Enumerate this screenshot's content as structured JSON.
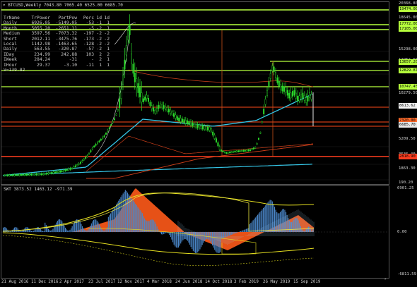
{
  "main": {
    "title": "BTCUSD,Weekly  7043.80 7065.40 6525.00 6685.70",
    "table": {
      "header": [
        "TrName",
        "TrPower",
        "PartPow",
        "Perc",
        "1d",
        "1d"
      ],
      "rows": [
        [
          "Daily",
          "6926.05",
          "-5149.05",
          "-53",
          "-1",
          "1"
        ],
        [
          "Month",
          "5055.20",
          "-2651.11",
          "-5",
          "-2",
          "1"
        ],
        [
          "Medium",
          "3597.56",
          "-7073.32",
          "-197",
          "-2",
          "-2"
        ],
        [
          "Short",
          "2012.11",
          "-3475.76",
          "-173",
          "-2",
          "-2"
        ],
        [
          "Local",
          "1142.98",
          "-1463.65",
          "-128",
          "-2",
          "-2"
        ],
        [
          "Daily",
          "563.55",
          "-320.87",
          "-57",
          "-2",
          "1"
        ],
        [
          "IDay",
          "234.99",
          "242.88",
          "103",
          "2",
          "2"
        ],
        [
          "IWeek",
          "284.24",
          "-31",
          "-",
          "2",
          "1"
        ],
        [
          "IHour",
          "29.37",
          "-3.10",
          "-11",
          "1",
          "1"
        ]
      ],
      "footer": "V=139.82"
    },
    "price_labels": [
      "20368.80",
      "18645.00",
      "15298.00",
      "11952.60",
      "10279.50",
      "5209.50",
      "3536.40",
      "1863.30",
      "190.20"
    ],
    "level_tags": [
      {
        "text": "19474.00",
        "color": "#b6ff3c"
      },
      {
        "text": "17772.00",
        "color": "#b6ff3c"
      },
      {
        "text": "17105.00",
        "color": "#b6ff3c"
      },
      {
        "text": "13657.20",
        "color": "#b6ff3c"
      },
      {
        "text": "12829.87",
        "color": "#b6ff3c"
      },
      {
        "text": "10747.45",
        "color": "#b6ff3c"
      },
      {
        "text": "8613.62",
        "color": "#f3f3f3"
      },
      {
        "text": "7320.00",
        "color": "#ff6a2a"
      },
      {
        "text": "6685.70",
        "color": "#e8e8e8"
      },
      {
        "text": "2818.90",
        "color": "#ff3d1f"
      }
    ]
  },
  "sub": {
    "title": "SWT 3873.52 1463.12 -971.39",
    "labels": [
      "6901.25",
      "0.00",
      "-6811.59"
    ]
  },
  "x_labels": [
    "21 Aug 2016",
    "11 Dec 2016",
    "2 Apr 2017",
    "23 Jul 2017",
    "12 Nov 2017",
    "4 Mar 2018",
    "24 Jun 2018",
    "14 Oct 2018",
    "3 Feb 2019",
    "26 May 2019",
    "15 Sep 2019"
  ],
  "colors": {
    "candle": "#2bdc2b",
    "level_green": "#b6ff3c",
    "level_red": "#ff3d1f",
    "cyan": "#35c5e6",
    "orange_band": "#ff5a1a",
    "blue_hist": "#4a86c8",
    "yellow": "#e6e020"
  },
  "icons": {
    "title_arrow": "dropdown-triangle-icon"
  }
}
